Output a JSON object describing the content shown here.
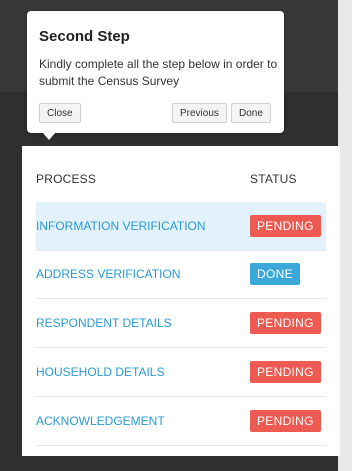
{
  "popover": {
    "title": "Second Step",
    "text": "Kindly complete all the step below in order to submit the Census Survey",
    "buttons": {
      "close": "Close",
      "previous": "Previous",
      "done": "Done"
    }
  },
  "table": {
    "headers": {
      "process": "PROCESS",
      "status": "STATUS"
    },
    "rows": [
      {
        "process": "INFORMATION VERIFICATION",
        "status": "PENDING"
      },
      {
        "process": "ADDRESS VERIFICATION",
        "status": "DONE"
      },
      {
        "process": "RESPONDENT DETAILS",
        "status": "PENDING"
      },
      {
        "process": "HOUSEHOLD DETAILS",
        "status": "PENDING"
      },
      {
        "process": "ACKNOWLEDGEMENT",
        "status": "PENDING"
      }
    ]
  },
  "colors": {
    "pending": "#ec5a52",
    "done": "#3aa8d8",
    "link": "#2a9ad3",
    "highlight_row": "#e3f1fb"
  }
}
